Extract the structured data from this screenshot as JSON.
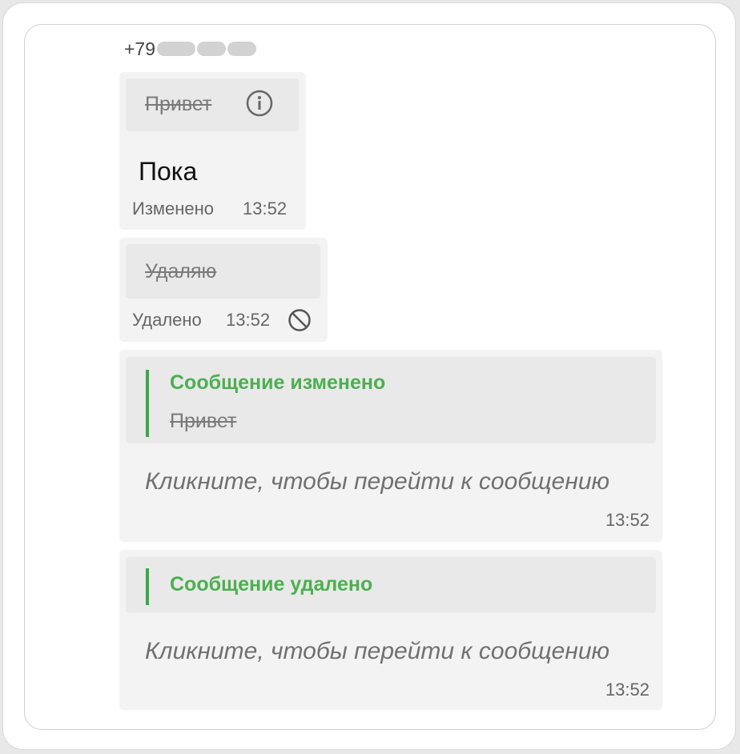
{
  "sender": {
    "phone_prefix": "+79"
  },
  "messages": [
    {
      "original_text": "Привет",
      "new_text": "Пока",
      "status_label": "Изменено",
      "time": "13:52"
    },
    {
      "original_text": "Удаляю",
      "status_label": "Удалено",
      "time": "13:52"
    }
  ],
  "notifications": [
    {
      "title": "Сообщение изменено",
      "quoted_text": "Привет",
      "hint": "Кликните, чтобы перейти к сообщению",
      "time": "13:52"
    },
    {
      "title": "Сообщение удалено",
      "hint": "Кликните, чтобы перейти к сообщению",
      "time": "13:52"
    }
  ],
  "colors": {
    "accent": "#4caf50",
    "bubble_bg": "#f3f3f3",
    "quote_bg": "#e9e9e9"
  },
  "icons": [
    "info-icon",
    "ban-icon"
  ]
}
